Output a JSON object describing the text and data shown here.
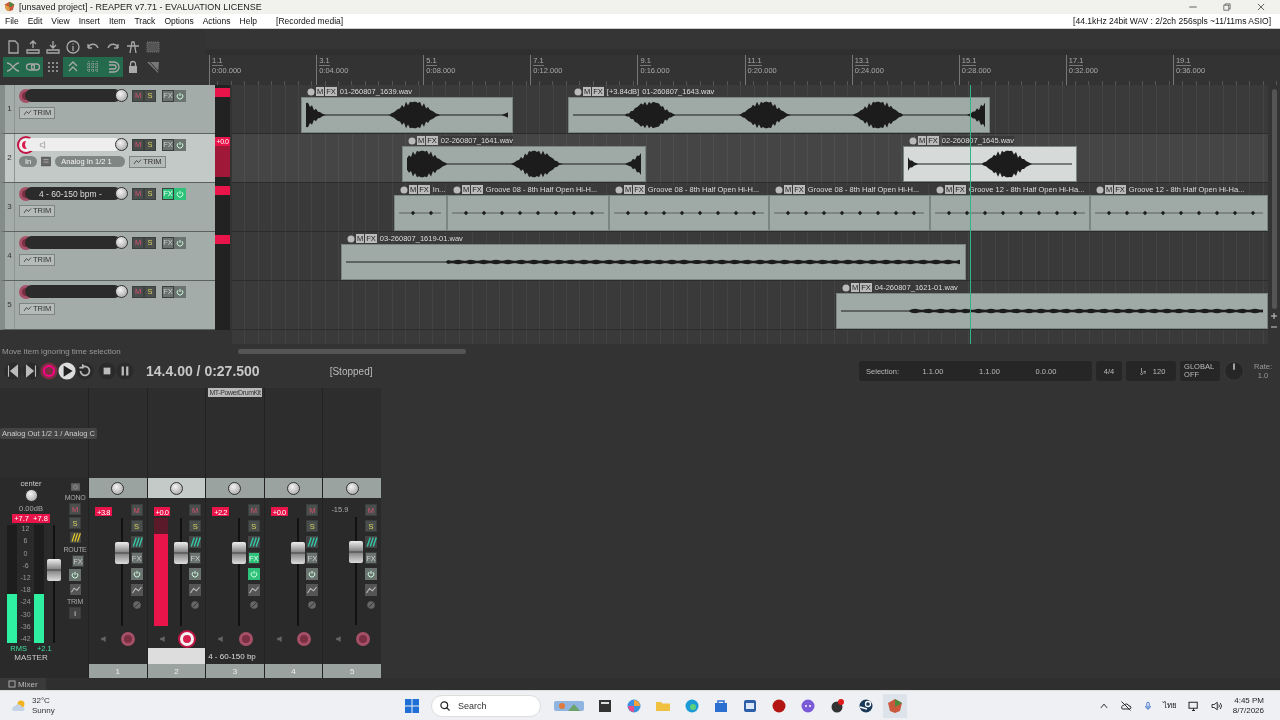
{
  "window": {
    "title": "[unsaved project] - REAPER v7.71 - EVALUATION LICENSE"
  },
  "menu": [
    "File",
    "Edit",
    "View",
    "Insert",
    "Item",
    "Track",
    "Options",
    "Actions",
    "Help"
  ],
  "menu_note": "[Recorded media]",
  "audio_status": "[44.1kHz 24bit WAV : 2/2ch 256spls ~11/11ms ASIO]",
  "toolbar": [
    [
      {
        "on": false
      },
      {
        "on": false
      },
      {
        "on": false
      },
      {
        "on": false
      },
      {
        "on": false
      },
      {
        "on": false
      },
      {
        "on": false
      },
      {
        "on": false
      }
    ],
    [
      {
        "on": true
      },
      {
        "on": true
      },
      {
        "on": false
      },
      {
        "on": true
      },
      {
        "on": true
      },
      {
        "on": true
      },
      {
        "on": false
      },
      {
        "on": false
      }
    ]
  ],
  "ruler": [
    {
      "bar": "1.1",
      "time": "0:00.000"
    },
    {
      "bar": "3.1",
      "time": "0:04.000"
    },
    {
      "bar": "5.1",
      "time": "0:08.000"
    },
    {
      "bar": "7.1",
      "time": "0:12.000"
    },
    {
      "bar": "9.1",
      "time": "0:16.000"
    },
    {
      "bar": "11.1",
      "time": "0:20.000"
    },
    {
      "bar": "13.1",
      "time": "0:24.000"
    },
    {
      "bar": "15.1",
      "time": "0:28.000"
    },
    {
      "bar": "17.1",
      "time": "0:32.000"
    },
    {
      "bar": "19.1",
      "time": "0:36.000"
    }
  ],
  "tracks": [
    {
      "number": "1",
      "selected": false,
      "armed": false,
      "fx_active": false,
      "meter_clip": true,
      "mute": "M",
      "solo": "S",
      "fx": "FX",
      "trim": "TRIM",
      "items": [
        {
          "name": "01-260807_1639.wav",
          "kind": "vocal",
          "selected": false,
          "tags": [
            "M",
            "FX"
          ]
        },
        {
          "gain": "[+3.84dB]",
          "name": "01-260807_1643.wav",
          "kind": "vocal",
          "selected": false,
          "tags": [
            "M",
            "FX"
          ]
        }
      ]
    },
    {
      "number": "2",
      "selected": true,
      "armed": true,
      "fx_active": false,
      "meter_clip": true,
      "meter_reading": "+0.0",
      "mute": "M",
      "solo": "S",
      "fx": "FX",
      "trim": "TRIM",
      "input": {
        "mode": "In",
        "source": "Analog In 1/2 1"
      },
      "items": [
        {
          "name": "02-260807_1641.wav",
          "kind": "vocal",
          "selected": false,
          "tags": [
            "M",
            "FX"
          ]
        },
        {
          "name": "02-260807_1645.wav",
          "kind": "vocal",
          "selected": true,
          "tags": [
            "M",
            "FX"
          ]
        }
      ]
    },
    {
      "number": "3",
      "name": "4 - 60-150 bpm -",
      "selected": false,
      "armed": false,
      "fx_active": true,
      "meter_clip": true,
      "mute": "M",
      "solo": "S",
      "fx": "FX",
      "trim": "TRIM",
      "items": [
        {
          "name": "In...",
          "kind": "drum",
          "selected": false,
          "tags": [
            "M",
            "FX"
          ]
        },
        {
          "name": "Groove 08 - 8th Half Open Hi-H...",
          "kind": "drum",
          "selected": false,
          "tags": [
            "M",
            "FX"
          ]
        },
        {
          "name": "Groove 08 - 8th Half Open Hi-H...",
          "kind": "drum",
          "selected": false,
          "tags": [
            "M",
            "FX"
          ]
        },
        {
          "name": "Groove 08 - 8th Half Open Hi-H...",
          "kind": "drum",
          "selected": false,
          "tags": [
            "M",
            "FX"
          ]
        },
        {
          "name": "Groove 12 - 8th Half Open Hi-Ha...",
          "kind": "drum",
          "selected": false,
          "tags": [
            "M",
            "FX"
          ]
        },
        {
          "name": "Groove 12 - 8th Half Open Hi-Ha...",
          "kind": "drum",
          "selected": false,
          "tags": [
            "M",
            "FX"
          ]
        }
      ]
    },
    {
      "number": "4",
      "selected": false,
      "armed": false,
      "fx_active": false,
      "meter_clip": true,
      "mute": "M",
      "solo": "S",
      "fx": "FX",
      "trim": "TRIM",
      "items": [
        {
          "name": "03-260807_1619-01.wav",
          "kind": "flat",
          "selected": false,
          "tags": [
            "M",
            "FX"
          ]
        }
      ]
    },
    {
      "number": "5",
      "selected": false,
      "armed": false,
      "fx_active": false,
      "meter_clip": false,
      "mute": "M",
      "solo": "S",
      "fx": "FX",
      "trim": "TRIM",
      "items": [
        {
          "name": "04-260807_1621-01.wav",
          "kind": "flat",
          "selected": false,
          "tags": [
            "M",
            "FX"
          ]
        }
      ]
    }
  ],
  "status": "Move item ignoring time selection",
  "transport": {
    "position": "14.4.00 / 0:27.500",
    "state": "[Stopped]",
    "selection": {
      "label": "Selection:",
      "start": "1.1.00",
      "end": "1.1.00",
      "length": "0.0.00"
    },
    "time_signature": "4/4",
    "tempo": "120",
    "automation": {
      "label": "GLOBAL",
      "mode": "OFF"
    },
    "rate": {
      "label": "Rate:",
      "value": "1.0"
    }
  },
  "mixer": {
    "master": {
      "output": "Analog Out 1/2 1 / Analog C",
      "pan_label": "center",
      "volume": "0.00dB",
      "peaks": [
        "+7.7",
        "+7.8"
      ],
      "scale": [
        "12",
        "6",
        "0",
        "-6",
        "-12",
        "-18",
        "-24",
        "-30",
        "-36",
        "-42"
      ],
      "meters": [
        {
          "level": 0.42
        },
        {
          "level": 0.42
        }
      ],
      "fader": {
        "level": 0.62
      },
      "rms_label": "RMS",
      "rms": "+2.1",
      "name": "MASTER",
      "mono": "MONO",
      "mute": "M",
      "solo": "S",
      "route": "ROUTE",
      "fx": "FX",
      "trim": "TRIM",
      "info": "i"
    },
    "strips": [
      {
        "number": "1",
        "peak": "+3.8",
        "clipped": true,
        "selected": false,
        "armed": false,
        "fx_active": false,
        "fader": {
          "level": 0.68
        },
        "mute": "M",
        "solo": "S",
        "fx": "FX"
      },
      {
        "number": "2",
        "peak": "+0.0",
        "clipped": true,
        "selected": true,
        "armed": true,
        "fx_active": false,
        "meter": {
          "level": 0.85
        },
        "fader": {
          "level": 0.68
        },
        "mute": "M",
        "solo": "S",
        "fx": "FX"
      },
      {
        "number": "3",
        "peak": "+2.2",
        "clipped": true,
        "selected": false,
        "armed": false,
        "fx_active": true,
        "insert": "MT-PowerDrumKit",
        "name": "4 - 60-150 bp",
        "fader": {
          "level": 0.68
        },
        "mute": "M",
        "solo": "S",
        "fx": "FX"
      },
      {
        "number": "4",
        "peak": "+0.0",
        "clipped": true,
        "selected": false,
        "armed": false,
        "fx_active": false,
        "fader": {
          "level": 0.68
        },
        "mute": "M",
        "solo": "S",
        "fx": "FX"
      },
      {
        "number": "5",
        "peak": "-15.9",
        "clipped": false,
        "selected": false,
        "armed": false,
        "fx_active": false,
        "fader": {
          "level": 0.68
        },
        "mute": "M",
        "solo": "S",
        "fx": "FX"
      }
    ],
    "tab": "Mixer"
  },
  "taskbar": {
    "weather": {
      "temp": "32°C",
      "condition": "Sunny"
    },
    "search": {
      "placeholder": "Search"
    },
    "language": "ไทย",
    "time": "4:45 PM",
    "date": "8/7/2026"
  }
}
